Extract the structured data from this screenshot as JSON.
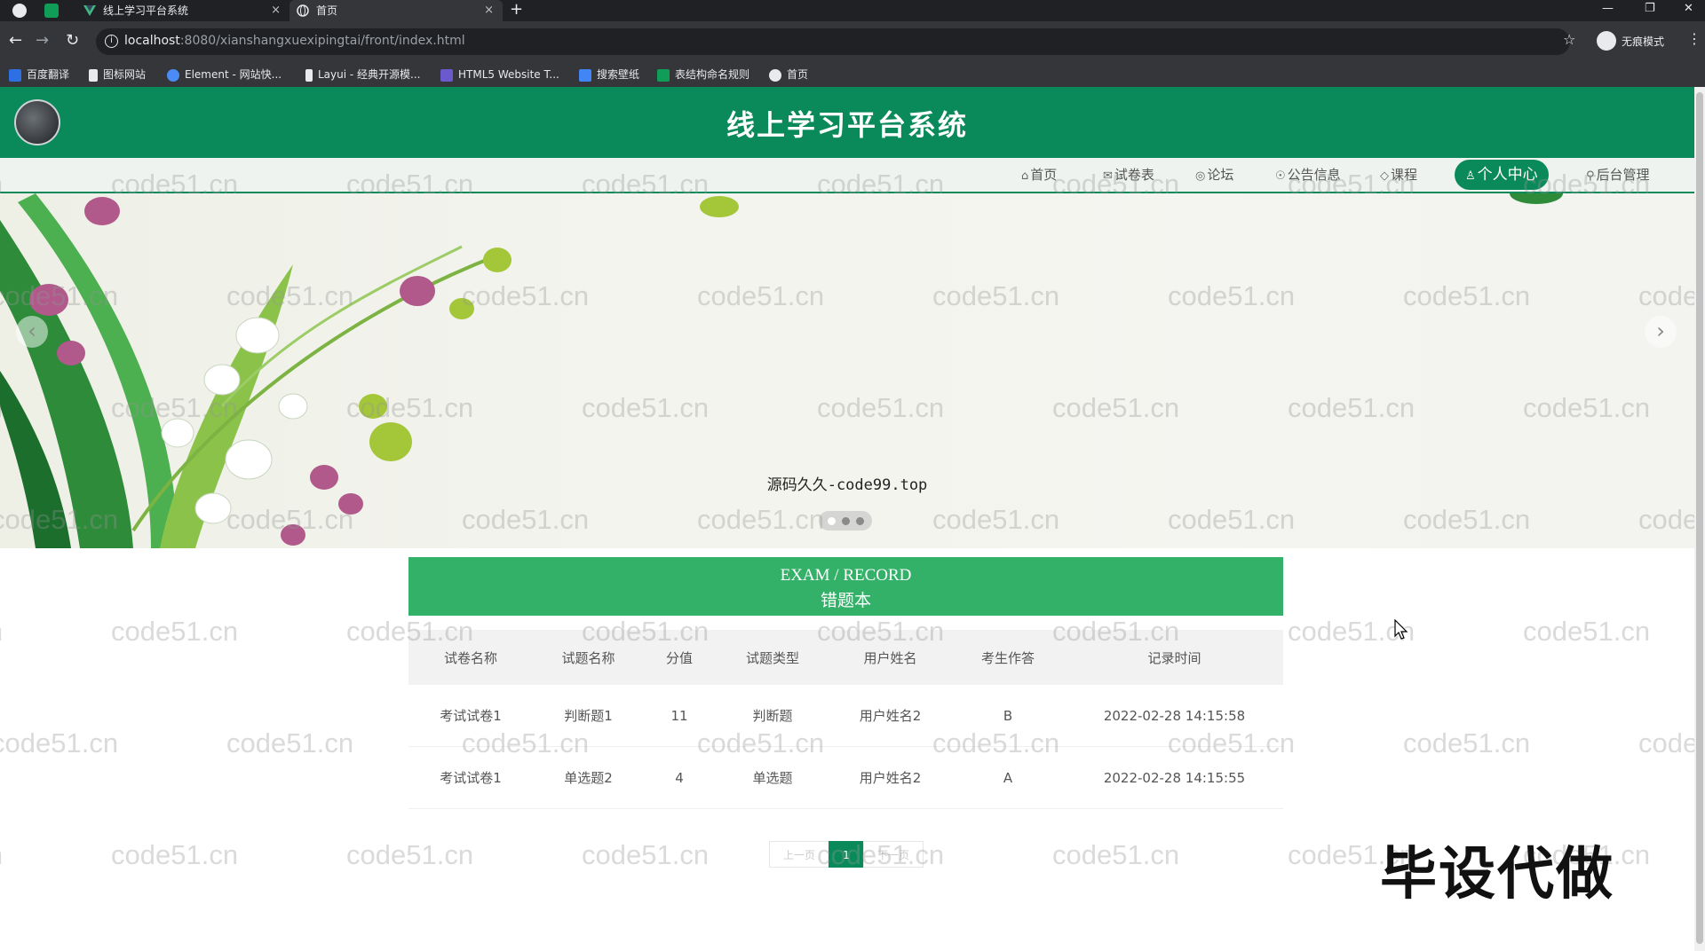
{
  "browser": {
    "tabs": [
      {
        "title": "线上学习平台系统",
        "active": false
      },
      {
        "title": "首页",
        "active": true
      }
    ],
    "new_tab": "+",
    "close": "×",
    "url_host": "localhost",
    "url_path": ":8080/xianshangxuexipingtai/front/index.html",
    "profile_label": "无痕模式",
    "bookmarks": [
      "百度翻译",
      "图标网站",
      "Element - 网站快...",
      "Layui - 经典开源模...",
      "HTML5 Website T...",
      "搜索壁纸",
      "表结构命名规则",
      "首页"
    ]
  },
  "header": {
    "title": "线上学习平台系统"
  },
  "nav": {
    "items": [
      {
        "icon": "⌂",
        "label": "首页"
      },
      {
        "icon": "✉",
        "label": "试卷表"
      },
      {
        "icon": "◎",
        "label": "论坛"
      },
      {
        "icon": "☉",
        "label": "公告信息"
      },
      {
        "icon": "◇",
        "label": "课程"
      },
      {
        "icon": "♙",
        "label": "个人中心"
      },
      {
        "icon": "⚲",
        "label": "后台管理"
      }
    ],
    "active_index": 5
  },
  "banner": {
    "caption": "源码久久-code99.top",
    "slide_count": 3,
    "current_slide": 1
  },
  "section": {
    "title_en": "EXAM / RECORD",
    "title_cn": "错题本"
  },
  "table": {
    "headers": [
      "试卷名称",
      "试题名称",
      "分值",
      "试题类型",
      "用户姓名",
      "考生作答",
      "记录时间"
    ],
    "rows": [
      [
        "考试试卷1",
        "判断题1",
        "11",
        "判断题",
        "用户姓名2",
        "B",
        "2022-02-28 14:15:58"
      ],
      [
        "考试试卷1",
        "单选题2",
        "4",
        "单选题",
        "用户姓名2",
        "A",
        "2022-02-28 14:15:55"
      ]
    ]
  },
  "pagination": {
    "prev": "上一页",
    "current": "1",
    "next": "下一页"
  },
  "watermark": "code51.cn",
  "overlay_stamp": "毕设代做",
  "colors": {
    "brand_green": "#0a8a5a",
    "section_green": "#34b169"
  }
}
